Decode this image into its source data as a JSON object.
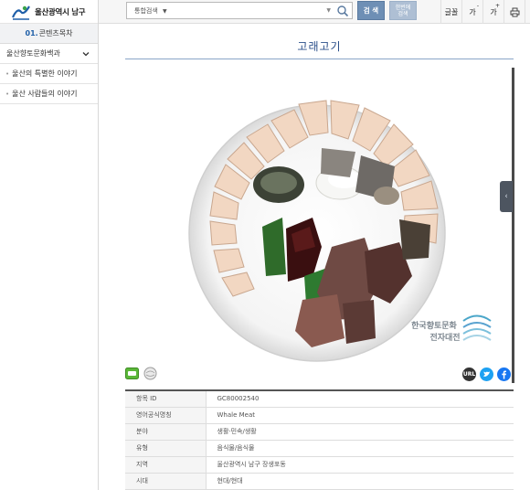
{
  "header": {
    "site_title": "울산광역시 남구",
    "search": {
      "category": "통합검색",
      "value": "",
      "placeholder": ""
    },
    "search_button": "검 색",
    "advanced_search_line1": "한번에",
    "advanced_search_line2": "검색",
    "tools": {
      "font_label": "글꼴",
      "font_smaller": "가",
      "font_smaller_mark": "-",
      "font_larger": "가",
      "font_larger_mark": "+"
    }
  },
  "sidebar": {
    "toc_number": "01.",
    "toc_label": "콘텐츠목차",
    "top_item": "울산향토문화백과",
    "items": [
      {
        "label": "울산의 특별한 이야기"
      },
      {
        "label": "울산 사람들의 이야기"
      }
    ]
  },
  "main": {
    "title": "고래고기",
    "watermark_line1": "한국향토문화",
    "watermark_line2": "전자대전",
    "share": {
      "url_label": "URL"
    },
    "info_rows": [
      {
        "key": "항목 ID",
        "value": "GC80002540"
      },
      {
        "key": "영어공식명칭",
        "value": "Whale Meat"
      },
      {
        "key": "분야",
        "value": "생활·민속/생활"
      },
      {
        "key": "유형",
        "value": "음식물/음식물"
      },
      {
        "key": "지역",
        "value": "울산광역시 남구 장생포동"
      },
      {
        "key": "시대",
        "value": "현대/현대"
      }
    ]
  },
  "colors": {
    "accent": "#2b4f8a",
    "search_button": "#6e8fb5",
    "twitter": "#1da1f2",
    "facebook": "#1877f2"
  }
}
